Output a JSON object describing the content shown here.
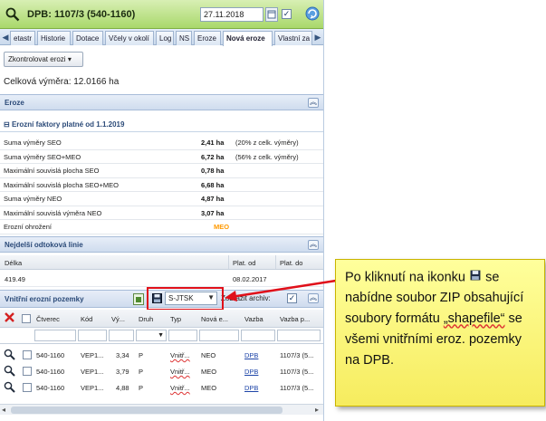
{
  "header": {
    "title": "DPB: 1107/3 (540-1160)",
    "date": "27.11.2018"
  },
  "tabs": [
    "etastr",
    "Historie",
    "Dotace",
    "Včely v okolí",
    "Log",
    "NS",
    "Eroze",
    "Nová eroze",
    "Vlastní za"
  ],
  "active_tab": "Nová eroze",
  "zkontrolovat_label": "Zkontrolovat erozi",
  "celkova_vymera": "Celková výměra: 12.0166 ha",
  "eroze_section": "Eroze",
  "faktory_title": "Erozní faktory platné od 1.1.2019",
  "factors": [
    {
      "label": "Suma výměry SEO",
      "value": "2,41 ha",
      "note": "(20% z celk. výměry)"
    },
    {
      "label": "Suma výměry SEO+MEO",
      "value": "6,72 ha",
      "note": "(56% z celk. výměry)"
    },
    {
      "label": "Maximální souvislá plocha SEO",
      "value": "0,78 ha",
      "note": ""
    },
    {
      "label": "Maximální souvislá plocha SEO+MEO",
      "value": "6,68 ha",
      "note": ""
    },
    {
      "label": "Suma výměry NEO",
      "value": "4,87 ha",
      "note": ""
    },
    {
      "label": "Maximální souvislá výměra NEO",
      "value": "3,07 ha",
      "note": ""
    },
    {
      "label": "Erozní ohrožení",
      "value": "MEO",
      "note": ""
    }
  ],
  "odtok_section": "Nejdelší odtoková linie",
  "odtok_headers": [
    "Délka",
    "Plat. od",
    "Plat. do"
  ],
  "odtok_row": {
    "delka": "419.49",
    "plat_od": "08.02.2017",
    "plat_do": ""
  },
  "vnitrni_section": "Vnitřní erozní pozemky",
  "format_select": "S-JTSK",
  "zobrazit_archiv": "Zobrazit archiv:",
  "vnitrni_headers": [
    "Čtverec",
    "Kód",
    "Vý...",
    "Druh",
    "Typ",
    "Nová e...",
    "Vazba",
    "Vazba p..."
  ],
  "vnitrni_rows": [
    {
      "ctverec": "540-1160",
      "kod": "VEP1...",
      "vymera": "3,34",
      "druh": "P",
      "typ": "Vnitř...",
      "nova": "NEO",
      "vazba": "DPB",
      "vazba_p": "1107/3 (5..."
    },
    {
      "ctverec": "540-1160",
      "kod": "VEP1...",
      "vymera": "3,79",
      "druh": "P",
      "typ": "Vnitř...",
      "nova": "MEO",
      "vazba": "DPB",
      "vazba_p": "1107/3 (5..."
    },
    {
      "ctverec": "540-1160",
      "kod": "VEP1...",
      "vymera": "4,88",
      "druh": "P",
      "typ": "Vnitř...",
      "nova": "MEO",
      "vazba": "DPB",
      "vazba_p": "1107/3 (5..."
    }
  ],
  "callout": {
    "part1": "Po kliknutí na ikonku",
    "part2": "se nabídne soubor ZIP obsahující soubory formátu",
    "quoted": "„shapefile“",
    "part3": "se všemi vnitřními eroz. pozemky na DPB."
  },
  "colors": {
    "accent_red": "#e0101a",
    "callout_yellow": "#ffff9c",
    "meo_orange": "#ff9900",
    "header_green": "#a9d86b"
  }
}
